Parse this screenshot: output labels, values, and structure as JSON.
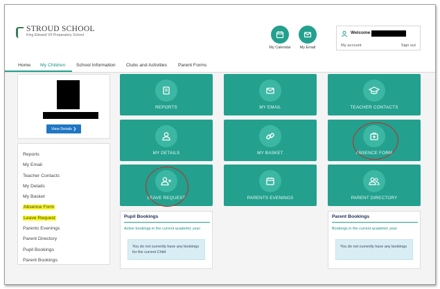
{
  "header": {
    "school_name": "STROUD SCHOOL",
    "school_subtitle": "King Edward VII Preparatory School",
    "quick_links": [
      {
        "label": "My Calendar",
        "icon": "calendar-icon"
      },
      {
        "label": "My Email",
        "icon": "envelope-icon"
      }
    ],
    "user": {
      "welcome": "Welcome",
      "my_account": "My account",
      "sign_out": "Sign out"
    }
  },
  "nav": {
    "items": [
      "Home",
      "My Children",
      "School Information",
      "Clubs and Activities",
      "Parent Forms"
    ],
    "active": "My Children"
  },
  "profile": {
    "view_details": "View Details ❯"
  },
  "side_menu": {
    "items": [
      {
        "label": "Reports",
        "highlighted": false
      },
      {
        "label": "My Email",
        "highlighted": false
      },
      {
        "label": "Teacher Contacts",
        "highlighted": false
      },
      {
        "label": "My Details",
        "highlighted": false
      },
      {
        "label": "My Basket",
        "highlighted": false
      },
      {
        "label": "Absence Form",
        "highlighted": true
      },
      {
        "label": "Leave Request",
        "highlighted": true
      },
      {
        "label": "Parents Evenings",
        "highlighted": false
      },
      {
        "label": "Parent Directory",
        "highlighted": false
      },
      {
        "label": "Pupil Bookings",
        "highlighted": false
      },
      {
        "label": "Parent Bookings",
        "highlighted": false
      }
    ]
  },
  "tiles": [
    {
      "label": "REPORTS",
      "icon": "book-icon"
    },
    {
      "label": "MY EMAIL",
      "icon": "envelope-icon"
    },
    {
      "label": "TEACHER CONTACTS",
      "icon": "graduation-cap-icon"
    },
    {
      "label": "MY DETAILS",
      "icon": "user-icon"
    },
    {
      "label": "MY BASKET",
      "icon": "link-icon"
    },
    {
      "label": "ABSENCE FORM",
      "icon": "medical-case-icon"
    },
    {
      "label": "LEAVE REQUEST",
      "icon": "user-remove-icon"
    },
    {
      "label": "PARENTS EVENINGS",
      "icon": "calendar-icon"
    },
    {
      "label": "PARENT DIRECTORY",
      "icon": "users-icon"
    }
  ],
  "bookings": {
    "pupil": {
      "title": "Pupil Bookings",
      "subtitle": "Active bookings in the current academic year:",
      "message": "You do not currently have any bookings for the current Child"
    },
    "parent": {
      "title": "Parent Bookings",
      "subtitle": "Bookings in the current academic year:",
      "message": "You do not currently have any bookings"
    }
  },
  "colors": {
    "accent": "#23a08e",
    "tile_circle": "#3cb7a4",
    "button_blue": "#1f77c4",
    "highlight_yellow": "#f6f516",
    "annotation_red": "#c62828"
  }
}
